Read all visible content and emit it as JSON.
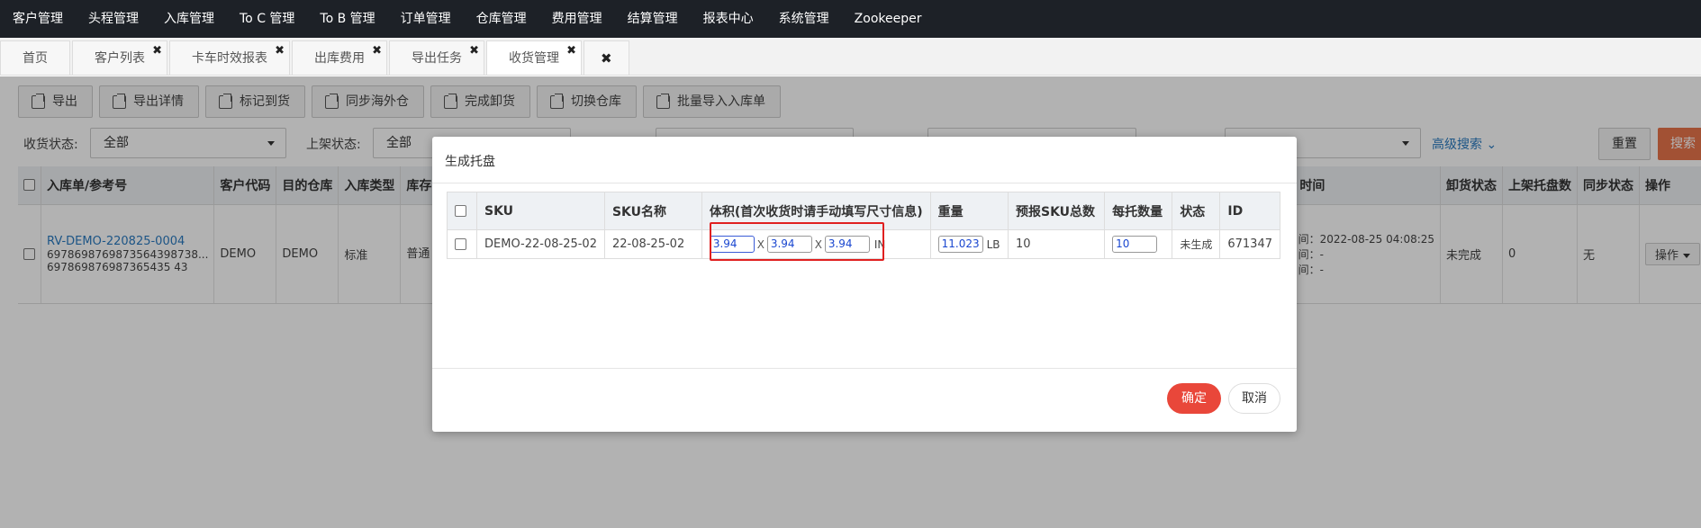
{
  "topnav": {
    "items": [
      "客户管理",
      "头程管理",
      "入库管理",
      "To C 管理",
      "To B 管理",
      "订单管理",
      "仓库管理",
      "费用管理",
      "结算管理",
      "报表中心",
      "系统管理",
      "Zookeeper"
    ]
  },
  "tabs": {
    "items": [
      {
        "label": "首页"
      },
      {
        "label": "客户列表"
      },
      {
        "label": "卡车时效报表"
      },
      {
        "label": "出库费用"
      },
      {
        "label": "导出任务"
      },
      {
        "label": "收货管理"
      }
    ],
    "close_symbol": "✖"
  },
  "toolbar": {
    "buttons": [
      "导出",
      "导出详情",
      "标记到货",
      "同步海外仓",
      "完成卸货",
      "切换仓库",
      "批量导入入库单"
    ]
  },
  "filters": {
    "receive_status_label": "收货状态:",
    "receive_status_value": "全部",
    "shelf_status_label": "上架状态:",
    "shelf_status_value": "全部",
    "advanced_search": "高级搜索",
    "reset": "重置",
    "search": "搜索"
  },
  "bg_table": {
    "headers": [
      "入库单/参考号",
      "客户代码",
      "目的仓库",
      "入库类型",
      "库存",
      "时间",
      "卸货状态",
      "上架托盘数",
      "同步状态",
      "操作"
    ],
    "row": {
      "order_no": "RV-DEMO-220825-0004",
      "ref_1": "6978698769873564398738...",
      "ref_2": "697869876987365435 43",
      "customer": "DEMO",
      "warehouse": "DEMO",
      "type": "标准",
      "stock": "普通",
      "time_1": "间：2022-08-25 04:08:25",
      "time_2": "间：-",
      "time_3": "间：-",
      "unload_status": "未完成",
      "pallets": "0",
      "sync": "无",
      "action": "操作"
    }
  },
  "modal": {
    "title": "生成托盘",
    "headers": [
      "SKU",
      "SKU名称",
      "体积(首次收货时请手动填写尺寸信息)",
      "重量",
      "预报SKU总数",
      "每托数量",
      "状态",
      "ID"
    ],
    "row": {
      "sku": "DEMO-22-08-25-02",
      "sku_name": "22-08-25-02",
      "length": "3.94",
      "width": "3.94",
      "height": "3.94",
      "dim_sep": "X",
      "dim_unit": "IN",
      "weight": "11.023",
      "weight_unit": "LB",
      "total": "10",
      "per_pallet": "10",
      "status": "未生成",
      "id": "671347"
    },
    "ok": "确定",
    "cancel": "取消"
  }
}
